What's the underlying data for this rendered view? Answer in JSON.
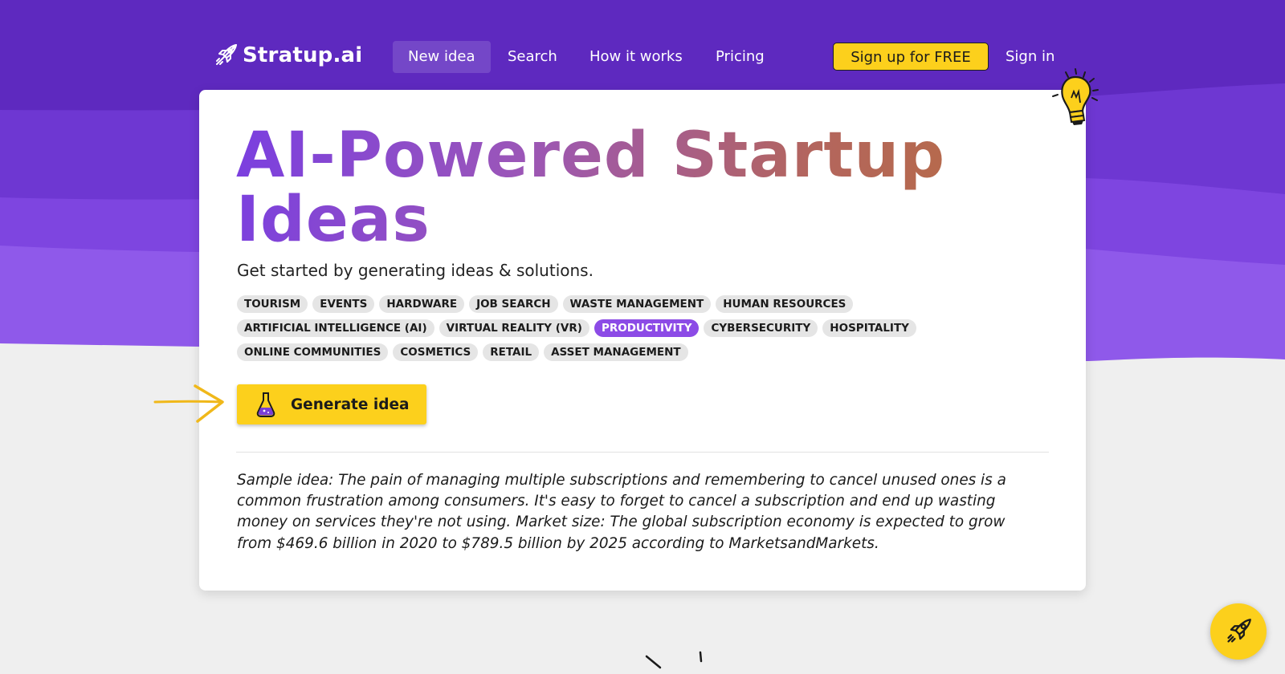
{
  "brand": {
    "name": "Stratup.ai",
    "accent": "#fcd01c",
    "purple": "#5f27c0",
    "tag_active": "#8c4be6"
  },
  "nav": {
    "items": [
      {
        "label": "New idea",
        "active": true
      },
      {
        "label": "Search"
      },
      {
        "label": "How it works"
      },
      {
        "label": "Pricing"
      }
    ],
    "signup_label": "Sign up for FREE",
    "signin_label": "Sign in"
  },
  "hero": {
    "title": "AI-Powered Startup Ideas",
    "subtitle": "Get started by generating ideas & solutions."
  },
  "tags": {
    "row1": [
      "TOURISM",
      "EVENTS",
      "HARDWARE",
      "JOB SEARCH",
      "WASTE MANAGEMENT",
      "HUMAN RESOURCES"
    ],
    "row2": [
      "ARTIFICIAL INTELLIGENCE (AI)",
      "VIRTUAL REALITY (VR)",
      "PRODUCTIVITY",
      "CYBERSECURITY",
      "HOSPITALITY"
    ],
    "row3": [
      "ONLINE COMMUNITIES",
      "COSMETICS",
      "RETAIL",
      "ASSET MANAGEMENT"
    ],
    "selected": "PRODUCTIVITY"
  },
  "generate": {
    "label": "Generate idea",
    "icon": "flask-icon"
  },
  "sample": {
    "text": "Sample idea: The pain of managing multiple subscriptions and remembering to cancel unused ones is a common frustration among consumers. It's easy to forget to cancel a subscription and end up wasting money on services they're not using. Market size: The global subscription economy is expected to grow from $469.6 billion in 2020 to $789.5 billion by 2025 according to MarketsandMarkets."
  },
  "icons": {
    "logo": "rocket-icon",
    "bulb": "lightbulb-icon",
    "arrow": "arrow-right-icon",
    "fab": "rocket-icon"
  }
}
